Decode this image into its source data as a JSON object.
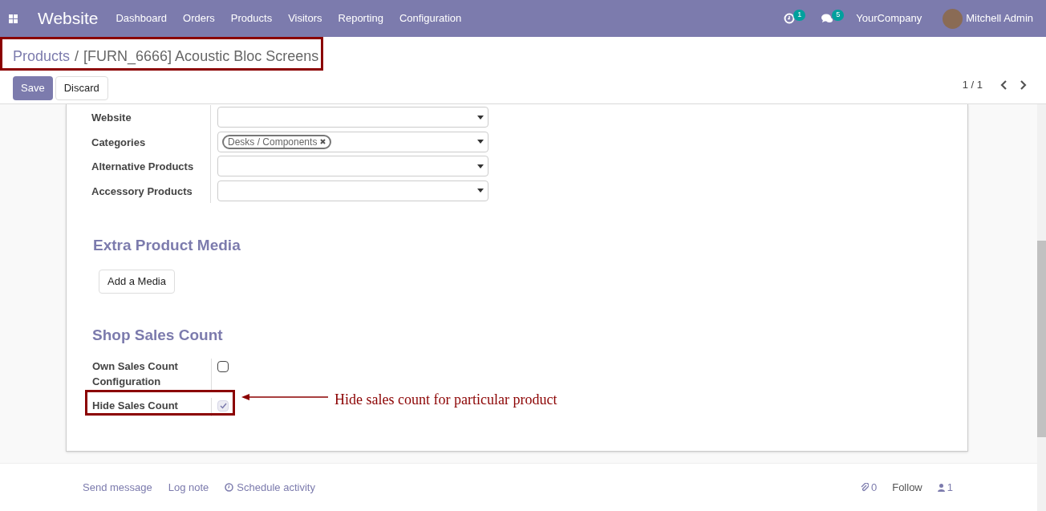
{
  "navbar": {
    "app_name": "Website",
    "menu": [
      "Dashboard",
      "Orders",
      "Products",
      "Visitors",
      "Reporting",
      "Configuration"
    ],
    "activity_count": "1",
    "message_count": "5",
    "company": "YourCompany",
    "user": "Mitchell Admin"
  },
  "breadcrumb": {
    "parent": "Products",
    "separator": "/",
    "current": "[FURN_6666] Acoustic Bloc Screens"
  },
  "buttons": {
    "save": "Save",
    "discard": "Discard"
  },
  "pager": {
    "value": "1 / 1"
  },
  "fields": [
    {
      "label": "Website"
    },
    {
      "label": "Categories",
      "tags": [
        "Desks / Components"
      ]
    },
    {
      "label": "Alternative Products"
    },
    {
      "label": "Accessory Products"
    }
  ],
  "media_section": {
    "title": "Extra Product Media",
    "button": "Add a Media"
  },
  "sales_section": {
    "title": "Shop Sales Count",
    "options": [
      {
        "label": "Own Sales Count Configuration",
        "checked": false,
        "disabled": false
      },
      {
        "label": "Hide Sales Count",
        "checked": true,
        "disabled": true
      }
    ]
  },
  "annotation": {
    "text": "Hide sales count for particular product"
  },
  "chatter": {
    "send_message": "Send message",
    "log_note": "Log note",
    "schedule_activity": "Schedule activity",
    "attachments": "0",
    "follow": "Follow",
    "followers": "1"
  }
}
